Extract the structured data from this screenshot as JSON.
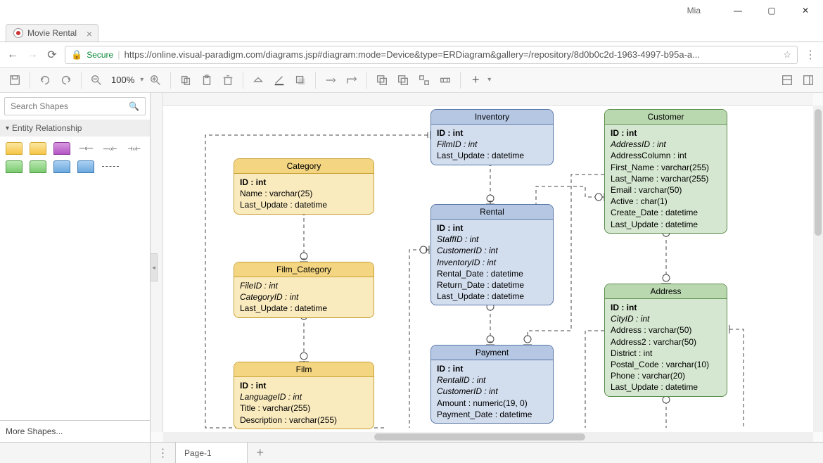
{
  "window": {
    "user": "Mia",
    "title": "Movie Rental"
  },
  "addressbar": {
    "secure_label": "Secure",
    "url": "https://online.visual-paradigm.com/diagrams.jsp#diagram:mode=Device&type=ERDiagram&gallery=/repository/8d0b0c2d-1963-4997-b95a-a..."
  },
  "toolbar": {
    "zoom": "100%"
  },
  "sidebar": {
    "search_placeholder": "Search Shapes",
    "palette_title": "Entity Relationship",
    "more_shapes": "More Shapes..."
  },
  "pages": {
    "current": "Page-1"
  },
  "entities": {
    "category": {
      "name": "Category",
      "rows": [
        {
          "text": "ID : int",
          "pk": true
        },
        {
          "text": "Name : varchar(25)"
        },
        {
          "text": "Last_Update : datetime"
        }
      ]
    },
    "film_category": {
      "name": "Film_Category",
      "rows": [
        {
          "text": "FileID : int",
          "fk": true
        },
        {
          "text": "CategoryID : int",
          "fk": true
        },
        {
          "text": "Last_Update : datetime"
        }
      ]
    },
    "film": {
      "name": "Film",
      "rows": [
        {
          "text": "ID : int",
          "pk": true
        },
        {
          "text": "LanguageID : int",
          "fk": true
        },
        {
          "text": "Title : varchar(255)"
        },
        {
          "text": "Description : varchar(255)"
        }
      ]
    },
    "inventory": {
      "name": "Inventory",
      "rows": [
        {
          "text": "ID : int",
          "pk": true
        },
        {
          "text": "FilmID : int",
          "fk": true
        },
        {
          "text": "Last_Update : datetime"
        }
      ]
    },
    "rental": {
      "name": "Rental",
      "rows": [
        {
          "text": "ID : int",
          "pk": true
        },
        {
          "text": "StaffID : int",
          "fk": true
        },
        {
          "text": "CustomerID : int",
          "fk": true
        },
        {
          "text": "InventoryID : int",
          "fk": true
        },
        {
          "text": "Rental_Date : datetime"
        },
        {
          "text": "Return_Date : datetime"
        },
        {
          "text": "Last_Update : datetime"
        }
      ]
    },
    "payment": {
      "name": "Payment",
      "rows": [
        {
          "text": "ID : int",
          "pk": true
        },
        {
          "text": "RentalID : int",
          "fk": true
        },
        {
          "text": "CustomerID : int",
          "fk": true
        },
        {
          "text": "Amount : numeric(19, 0)"
        },
        {
          "text": "Payment_Date : datetime"
        }
      ]
    },
    "customer": {
      "name": "Customer",
      "rows": [
        {
          "text": "ID : int",
          "pk": true
        },
        {
          "text": "AddressID : int",
          "fk": true
        },
        {
          "text": "AddressColumn : int"
        },
        {
          "text": "First_Name : varchar(255)"
        },
        {
          "text": "Last_Name : varchar(255)"
        },
        {
          "text": "Email : varchar(50)"
        },
        {
          "text": "Active : char(1)"
        },
        {
          "text": "Create_Date : datetime"
        },
        {
          "text": "Last_Update : datetime"
        }
      ]
    },
    "address": {
      "name": "Address",
      "rows": [
        {
          "text": "ID : int",
          "pk": true
        },
        {
          "text": "CityID : int",
          "fk": true
        },
        {
          "text": "Address : varchar(50)"
        },
        {
          "text": "Address2 : varchar(50)"
        },
        {
          "text": "District : int"
        },
        {
          "text": "Postal_Code : varchar(10)"
        },
        {
          "text": "Phone : varchar(20)"
        },
        {
          "text": "Last_Update : datetime"
        }
      ]
    }
  }
}
